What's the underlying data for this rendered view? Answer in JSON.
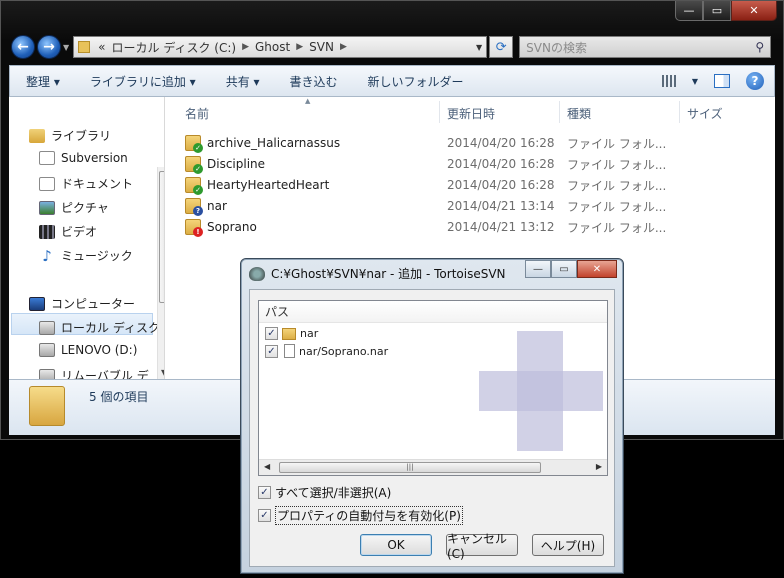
{
  "explorer": {
    "caption_buttons": [
      "—",
      "▭",
      "✕"
    ],
    "address": {
      "prefix": "«",
      "crumbs": [
        "ローカル ディスク (C:)",
        "Ghost",
        "SVN"
      ]
    },
    "search_placeholder": "SVNの検索",
    "toolbar": [
      "整理 ▾",
      "ライブラリに追加 ▾",
      "共有 ▾",
      "書き込む",
      "新しいフォルダー"
    ],
    "nav": {
      "libraries": "ライブラリ",
      "subversion": "Subversion",
      "documents": "ドキュメント",
      "pictures": "ピクチャ",
      "videos": "ビデオ",
      "music": "ミュージック",
      "computer": "コンピューター",
      "local_disk": "ローカル ディスク",
      "lenovo": "LENOVO (D:)",
      "removable": "リムーバブル デ"
    },
    "columns": {
      "name": "名前",
      "date": "更新日時",
      "type": "種類",
      "size": "サイズ"
    },
    "files": [
      {
        "name": "archive_Halicarnassus",
        "date": "2014/04/20 16:28",
        "type": "ファイル フォル...",
        "overlay": "ok"
      },
      {
        "name": "Discipline",
        "date": "2014/04/20 16:28",
        "type": "ファイル フォル...",
        "overlay": "ok"
      },
      {
        "name": "HeartyHeartedHeart",
        "date": "2014/04/20 16:28",
        "type": "ファイル フォル...",
        "overlay": "ok"
      },
      {
        "name": "nar",
        "date": "2014/04/21 13:14",
        "type": "ファイル フォル...",
        "overlay": "q"
      },
      {
        "name": "Soprano",
        "date": "2014/04/21 13:12",
        "type": "ファイル フォル...",
        "overlay": "err"
      }
    ],
    "item_count": "5 個の項目"
  },
  "dialog": {
    "title": "C:¥Ghost¥SVN¥nar - 追加 - TortoiseSVN",
    "caption_buttons": [
      "—",
      "▭",
      "✕"
    ],
    "list_header": "パス",
    "items": [
      {
        "path": "nar",
        "checked": "✓"
      },
      {
        "path": "nar/Soprano.nar",
        "checked": "✓"
      }
    ],
    "select_all": "すべて選択/非選択(A)",
    "auto_props": "プロパティの自動付与を有効化(P)",
    "ok": "OK",
    "cancel": "キャンセル(C)",
    "help": "ヘルプ(H)",
    "colors": {
      "accent": "#2a6fc2",
      "ok_overlay": "#2e9a2e",
      "question_overlay": "#2a4fa0",
      "error_overlay": "#dd2222"
    }
  }
}
